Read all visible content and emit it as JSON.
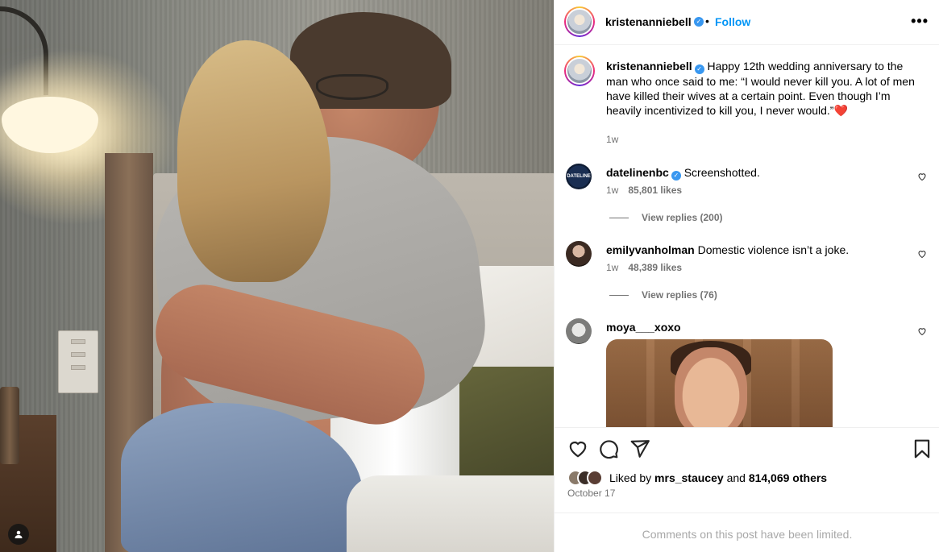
{
  "post": {
    "username": "kristenanniebell",
    "verified_mark": "✓",
    "separator": "•",
    "follow_label": "Follow",
    "more_label": "•••",
    "caption_text": "Happy 12th wedding anniversary to the man who once said to me: “I would never kill you. A lot of men have killed their wives at a certain point. Even though I’m heavily incentivized to kill you, I never would.”",
    "caption_emoji": "❤️",
    "caption_time": "1w"
  },
  "comments": [
    {
      "username": "datelinenbc",
      "verified": true,
      "avatar_label": "DATELINE",
      "text": "Screenshotted.",
      "time": "1w",
      "likes": "85,801 likes",
      "replies": "View replies (200)"
    },
    {
      "username": "emilyvanholman",
      "verified": false,
      "text": "Domestic violence isn’t a joke.",
      "time": "1w",
      "likes": "48,389 likes",
      "replies": "View replies (76)"
    },
    {
      "username": "moya___xoxo",
      "verified": false,
      "text": ""
    }
  ],
  "footer": {
    "liked_prefix": "Liked by",
    "liked_user": "mrs_staucey",
    "liked_and": "and",
    "liked_count": "814,069 others",
    "date": "October 17",
    "comments_limited": "Comments on this post have been limited."
  },
  "icons": {
    "like": "heart-icon",
    "comment": "comment-icon",
    "share": "share-icon",
    "save": "bookmark-icon"
  },
  "colors": {
    "follow_blue": "#0095f6",
    "verified_blue": "#3897f0",
    "muted_text": "#737373",
    "limited_text": "#a8a8a8",
    "heart_red": "#e0245e"
  }
}
